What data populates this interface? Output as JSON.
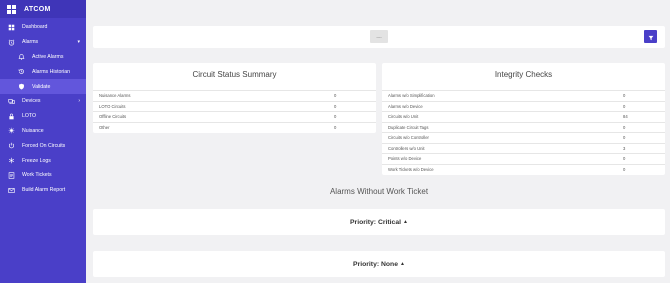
{
  "app": {
    "title": "ATCOM"
  },
  "sidebar": {
    "items": [
      {
        "label": "Dashboard",
        "icon": "dashboard-icon"
      },
      {
        "label": "Alarms",
        "icon": "alarm-icon",
        "caret": "▾"
      },
      {
        "label": "Active Alarms",
        "icon": "bell-icon"
      },
      {
        "label": "Alarms Historian",
        "icon": "history-icon"
      },
      {
        "label": "Validate",
        "icon": "shield-icon"
      },
      {
        "label": "Devices",
        "icon": "devices-icon",
        "caret": "›"
      },
      {
        "label": "LOTO",
        "icon": "lock-icon"
      },
      {
        "label": "Nuisance",
        "icon": "nuisance-icon"
      },
      {
        "label": "Forced On Circuits",
        "icon": "power-icon"
      },
      {
        "label": "Freeze Logs",
        "icon": "snowflake-icon"
      },
      {
        "label": "Work Tickets",
        "icon": "ticket-icon"
      },
      {
        "label": "Build Alarm Report",
        "icon": "report-icon"
      }
    ]
  },
  "filterbar": {
    "select_label": "----"
  },
  "circuit_summary": {
    "title": "Circuit Status Summary",
    "rows": [
      {
        "label": "Nuisance Alarms",
        "value": "0"
      },
      {
        "label": "LOTO Circuits",
        "value": "0"
      },
      {
        "label": "Offline Circuits",
        "value": "0"
      },
      {
        "label": "Other",
        "value": "0"
      }
    ]
  },
  "integrity_checks": {
    "title": "Integrity Checks",
    "rows": [
      {
        "label": "Alarms w/o Simplification",
        "value": "0"
      },
      {
        "label": "Alarms w/o Device",
        "value": "0"
      },
      {
        "label": "Circuits w/o Unit",
        "value": "84"
      },
      {
        "label": "Duplicate Circuit Tags",
        "value": "0"
      },
      {
        "label": "Circuits w/o Controller",
        "value": "0"
      },
      {
        "label": "Controllers w/o Unit",
        "value": "3"
      },
      {
        "label": "Points w/o Device",
        "value": "0"
      },
      {
        "label": "Work Tickets w/o Device",
        "value": "0"
      }
    ]
  },
  "alarms_section": {
    "title": "Alarms Without Work Ticket",
    "priorities": [
      {
        "label": "Priority: Critical",
        "arrow": "▲"
      },
      {
        "label": "Priority: None",
        "arrow": "▲"
      }
    ]
  },
  "colors": {
    "sidebar": "#4a3fc8",
    "accent": "#4a3fc8",
    "background": "#f1f1f3"
  }
}
